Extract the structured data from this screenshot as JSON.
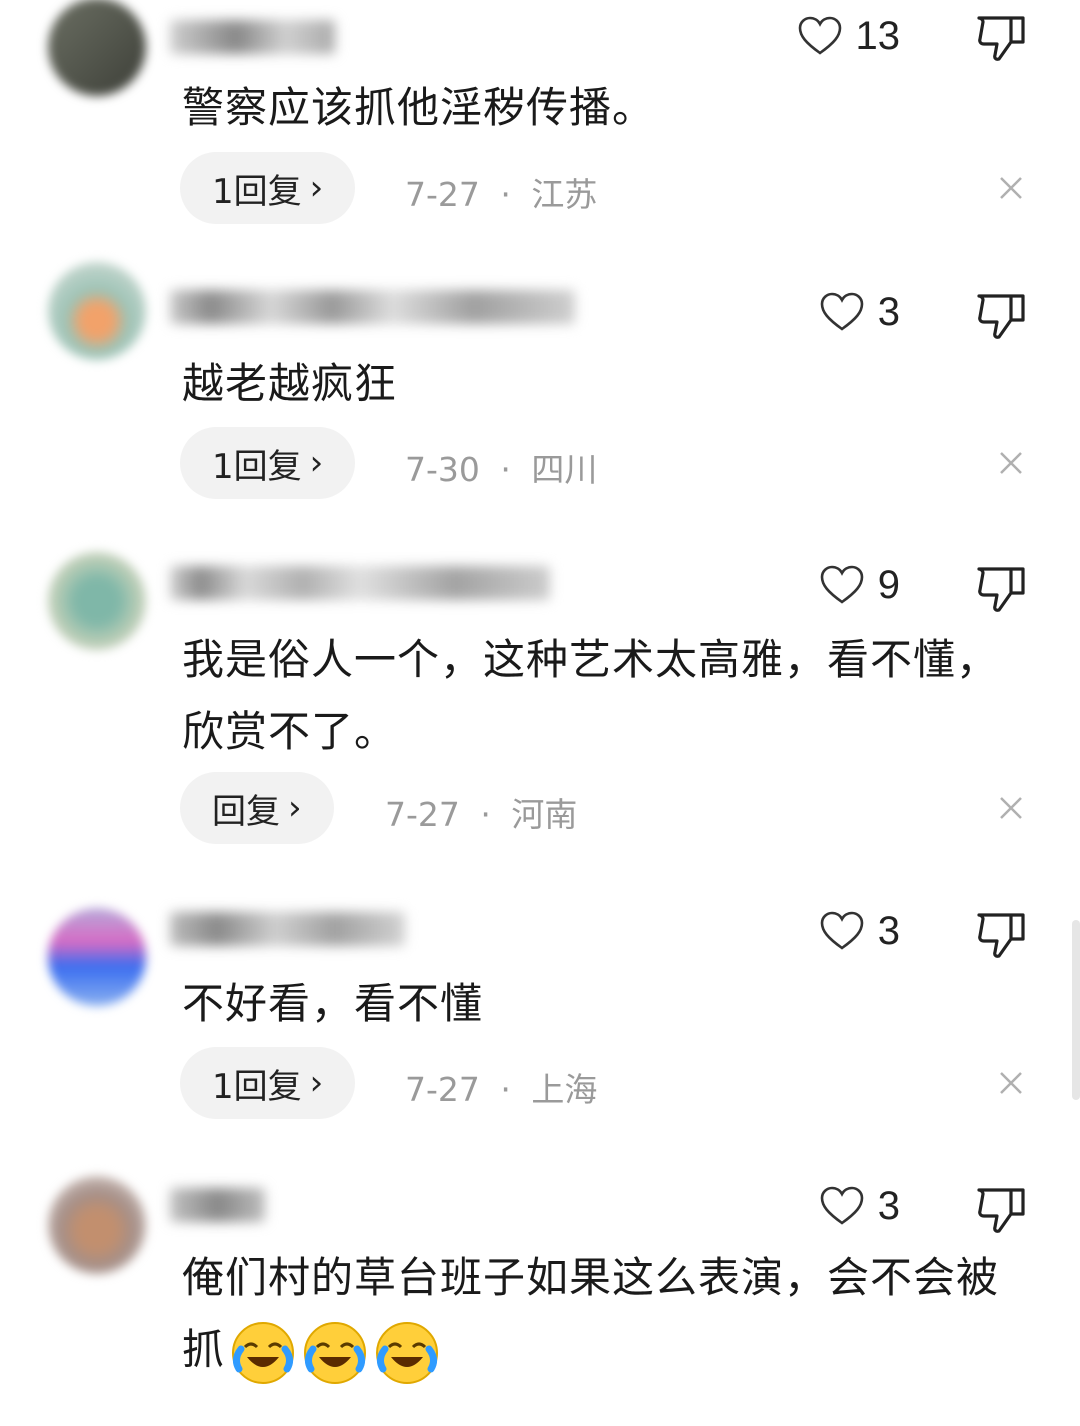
{
  "comments": [
    {
      "likes": "13",
      "text": "警察应该抓他淫秽传播。",
      "reply_label": "1回复",
      "date": "7-27",
      "region": "江苏"
    },
    {
      "likes": "3",
      "text": "越老越疯狂",
      "reply_label": "1回复",
      "date": "7-30",
      "region": "四川"
    },
    {
      "likes": "9",
      "text": "我是俗人一个，这种艺术太高雅，看不懂，欣赏不了。",
      "reply_label": "回复",
      "date": "7-27",
      "region": "河南"
    },
    {
      "likes": "3",
      "text": "不好看，看不懂",
      "reply_label": "1回复",
      "date": "7-27",
      "region": "上海"
    },
    {
      "likes": "3",
      "text": "俺们村的草台班子如果这么表演，会不会被抓",
      "emoji_count": 3
    }
  ],
  "meta_separator": "·",
  "icons": {
    "like": "heart-outline-icon",
    "dislike": "thumbs-down-icon",
    "close": "close-icon",
    "reply_chevron": "chevron-right-icon",
    "emoji": "crying-laughing-emoji"
  },
  "colors": {
    "meta_gray": "#9a9a9a",
    "pill_bg": "#f2f2f2",
    "text": "#1a1a1a"
  }
}
